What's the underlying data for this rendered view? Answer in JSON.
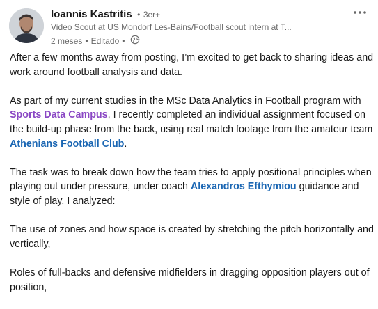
{
  "author": {
    "name": "Ioannis Kastritis",
    "separator": "•",
    "degree": "3er+",
    "headline": "Video Scout at US Mondorf Les-Bains/Football scout intern at T...",
    "time_ago": "2 meses",
    "meta_separator": "•",
    "edited": "Editado",
    "meta_separator_2": "•"
  },
  "icons": {
    "more": "more-horizontal-icon",
    "visibility": "globe-icon",
    "avatar": "avatar-photo"
  },
  "colors": {
    "mention_purple": "#8a47c4",
    "mention_blue": "#1a66b3"
  },
  "post": {
    "p1": "After a few months away from posting, I’m excited to get back to sharing ideas and work around football analysis and data.",
    "p2_a": "As part of my current studies in the MSc Data Analytics in Football program with ",
    "p2_mention": "Sports Data Campus",
    "p2_b": ", I recently completed an individual assignment focused on the build-up phase from the back, using real match footage from the amateur team ",
    "p2_mention2": "Athenians Football Club",
    "p2_c": ".",
    "p3_a": "The task was to break down how the team tries to apply positional principles when playing out under pressure, under coach ",
    "p3_mention": "Alexandros Efthymiou",
    "p3_b": " guidance and style of play. I analyzed:",
    "p4": "The use of zones and how space is created by stretching the pitch horizontally and vertically,",
    "p5": "Roles of full-backs and defensive midfielders in dragging opposition players out of position,"
  }
}
